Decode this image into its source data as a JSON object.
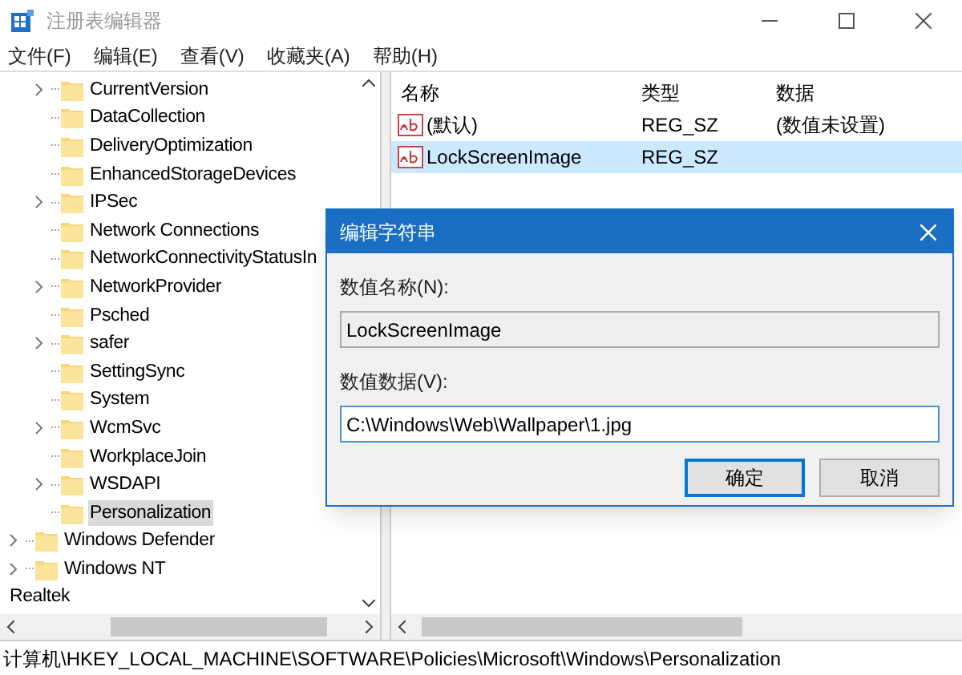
{
  "window": {
    "title": "注册表编辑器"
  },
  "menu": [
    "文件(F)",
    "编辑(E)",
    "查看(V)",
    "收藏夹(A)",
    "帮助(H)"
  ],
  "tree": {
    "children": [
      {
        "children": [
          {
            "children": [
              {
                "label": "CurrentVersion",
                "expandable": true,
                "selected": false
              },
              {
                "label": "DataCollection",
                "expandable": false,
                "selected": false
              },
              {
                "label": "DeliveryOptimization",
                "expandable": false,
                "selected": false
              },
              {
                "label": "EnhancedStorageDevices",
                "expandable": false,
                "selected": false
              },
              {
                "label": "IPSec",
                "expandable": true,
                "selected": false
              },
              {
                "label": "Network Connections",
                "expandable": false,
                "selected": false
              },
              {
                "label": "NetworkConnectivityStatusIn",
                "expandable": false,
                "selected": false
              },
              {
                "label": "NetworkProvider",
                "expandable": true,
                "selected": false
              },
              {
                "label": "Psched",
                "expandable": false,
                "selected": false
              },
              {
                "label": "safer",
                "expandable": true,
                "selected": false
              },
              {
                "label": "SettingSync",
                "expandable": false,
                "selected": false
              },
              {
                "label": "System",
                "expandable": false,
                "selected": false
              },
              {
                "label": "WcmSvc",
                "expandable": true,
                "selected": false
              },
              {
                "label": "WorkplaceJoin",
                "expandable": false,
                "selected": false
              },
              {
                "label": "WSDAPI",
                "expandable": true,
                "selected": false
              },
              {
                "label": "Personalization",
                "expandable": false,
                "selected": true
              }
            ]
          },
          {
            "label": "Windows Defender",
            "expandable": true,
            "selected": false
          },
          {
            "label": "Windows NT",
            "expandable": true,
            "selected": false
          }
        ]
      },
      {
        "label": "Realtek",
        "expandable": false,
        "selected": false
      }
    ]
  },
  "values": {
    "columns": [
      "名称",
      "类型",
      "数据"
    ],
    "rows": [
      {
        "name": "(默认)",
        "type": "REG_SZ",
        "data": "(数值未设置)",
        "selected": false
      },
      {
        "name": "LockScreenImage",
        "type": "REG_SZ",
        "selected": true
      }
    ]
  },
  "dialog": {
    "title": "编辑字符串",
    "name_label": "数值名称(N):",
    "name_value": "LockScreenImage",
    "data_label": "数值数据(V):",
    "data_value": "C:\\Windows\\Web\\Wallpaper\\1.jpg",
    "buttons": [
      {
        "label": "确定",
        "default": true
      },
      {
        "label": "取消",
        "default": false
      }
    ]
  },
  "status_bar": "计算机\\HKEY_LOCAL_MACHINE\\SOFTWARE\\Policies\\Microsoft\\Windows\\Personalization"
}
